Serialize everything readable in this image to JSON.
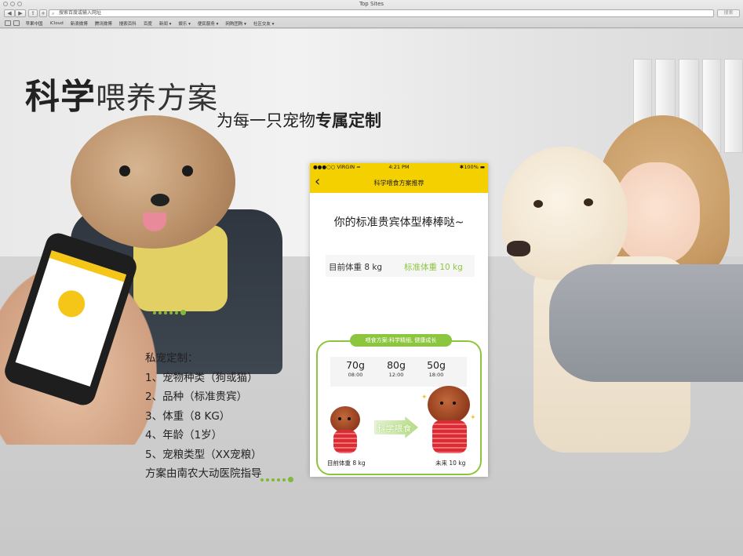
{
  "browser": {
    "window_title": "Top Sites",
    "address_placeholder": "搜索百度或输入网址",
    "go_label": "搜索",
    "bookmarks": [
      "苹果中国",
      "iCloud",
      "新浪微博",
      "腾讯微博",
      "搜索百科",
      "百度",
      "新闻 ▾",
      "娱乐 ▾",
      "便民服务 ▾",
      "网购团购 ▾",
      "社区交友 ▾"
    ]
  },
  "banner": {
    "headline_bold": "科学",
    "headline_rest": "喂养方案",
    "subline_plain": "为每一只宠物",
    "subline_bold": "专属定制",
    "custom_list": [
      "私宠定制：",
      "1、宠物种类（狗或猫）",
      "2、品种（标准贵宾）",
      "3、体重（8 KG）",
      "4、年龄（1岁）",
      "5、宠粮类型（XX宠粮）",
      "方案由南农大动医院指导"
    ]
  },
  "phone": {
    "status": {
      "carrier": "●●●○○ VIRGIN ≈",
      "time": "4:21 PM",
      "battery": "✱100% ▬"
    },
    "nav_title": "科学喂食方案推荐",
    "message": "你的标准贵宾体型棒棒哒~",
    "current_weight": "目前体重 8 kg",
    "standard_weight": "标准体重 10 kg",
    "plan_tag": "喂食方案:科学精细, 健康成长",
    "meals": [
      {
        "amount": "70g",
        "time": "08:00"
      },
      {
        "amount": "80g",
        "time": "12:00"
      },
      {
        "amount": "50g",
        "time": "18:00"
      }
    ],
    "arrow_label": "科学喂食",
    "caption_current": "目前体重 8 kg",
    "caption_future": "未来 10 kg"
  },
  "colors": {
    "accent_yellow": "#f5d000",
    "accent_green": "#8cc63f"
  }
}
